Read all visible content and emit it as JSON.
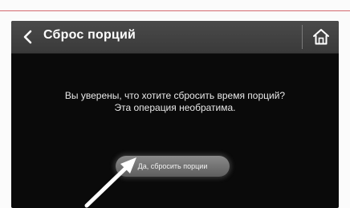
{
  "screen": {
    "title": "Сброс порций",
    "back_icon": "chevron-left-icon",
    "home_icon": "home-icon"
  },
  "dialog": {
    "message_line1": "Вы уверены, что хотите сбросить время порций?",
    "message_line2": "Эта операция необратима.",
    "confirm_label": "Да, сбросить порции"
  },
  "annotation": {
    "pointer_icon": "arrow-pointer-icon"
  },
  "colors": {
    "top_rule": "#d36a70",
    "titlebar": "#424242",
    "screen_bg": "#0a0a0a",
    "button": "#707070",
    "text": "#ffffff"
  }
}
